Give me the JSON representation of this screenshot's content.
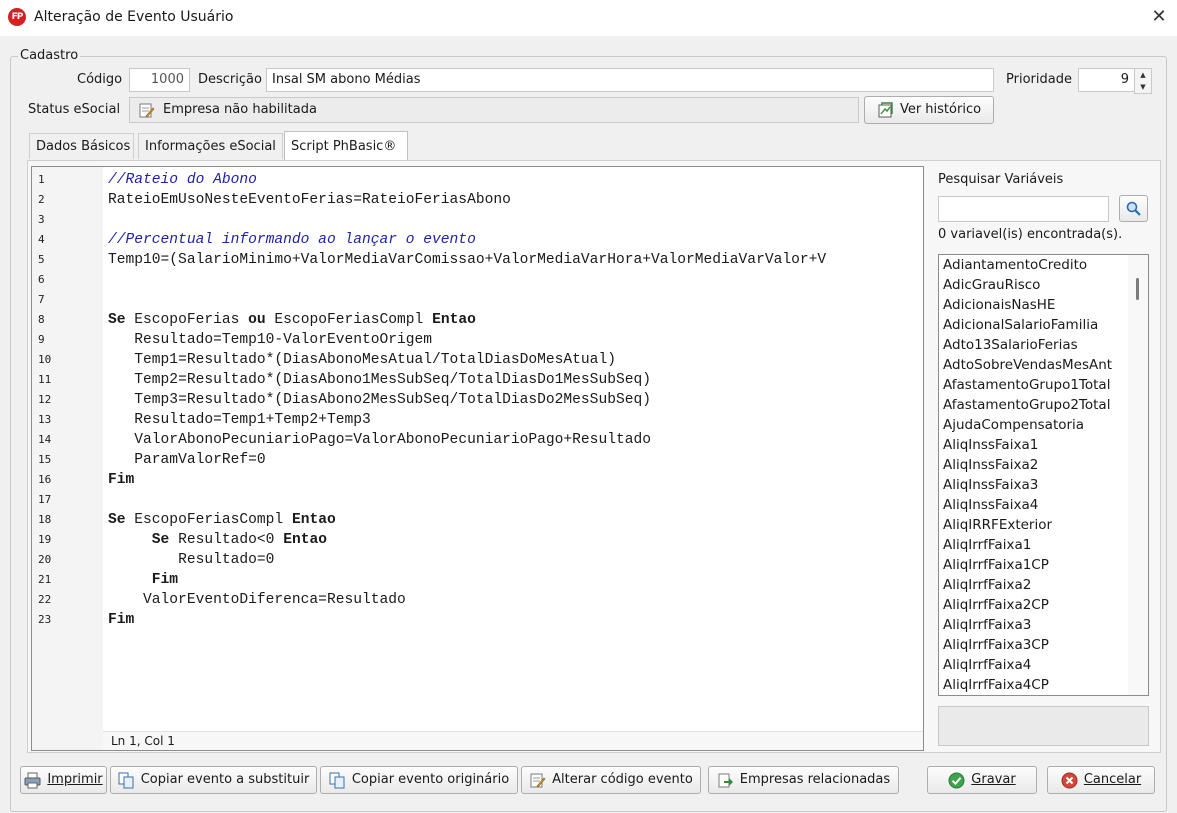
{
  "window": {
    "logo_text": "FP",
    "title": "Alteração de Evento Usuário",
    "close_glyph": "✕"
  },
  "cadastro": {
    "legend": "Cadastro",
    "codigo_label": "Código",
    "codigo_value": "1000",
    "descricao_label": "Descrição",
    "descricao_value": "Insal SM abono Médias",
    "prioridade_label": "Prioridade",
    "prioridade_value": "9",
    "status_label": "Status eSocial",
    "status_value": "Empresa não habilitada",
    "ver_historico": "Ver histórico"
  },
  "tabs": [
    {
      "label": "Dados Básicos",
      "active": false
    },
    {
      "label": "Informações eSocial",
      "active": false
    },
    {
      "label": "Script PhBasic®",
      "active": true
    }
  ],
  "editor": {
    "line_numbers": [
      "1",
      "2",
      "3",
      "4",
      "5",
      "6",
      "7",
      "8",
      "9",
      "10",
      "11",
      "12",
      "13",
      "14",
      "15",
      "16",
      "17",
      "18",
      "19",
      "20",
      "21",
      "22",
      "23"
    ],
    "lines": [
      "//Rateio do Abono",
      "RateioEmUsoNesteEventoFerias=RateioFeriasAbono",
      "",
      "//Percentual informando ao lançar o evento",
      "Temp10=(SalarioMinimo+ValorMediaVarComissao+ValorMediaVarHora+ValorMediaVarValor+V",
      "",
      "",
      "Se EscopoFerias ou EscopoFeriasCompl Entao",
      "   Resultado=Temp10-ValorEventoOrigem",
      "   Temp1=Resultado*(DiasAbonoMesAtual/TotalDiasDoMesAtual)",
      "   Temp2=Resultado*(DiasAbono1MesSubSeq/TotalDiasDo1MesSubSeq)",
      "   Temp3=Resultado*(DiasAbono2MesSubSeq/TotalDiasDo2MesSubSeq)",
      "   Resultado=Temp1+Temp2+Temp3",
      "   ValorAbonoPecuniarioPago=ValorAbonoPecuniarioPago+Resultado",
      "   ParamValorRef=0",
      "Fim",
      "",
      "Se EscopoFeriasCompl Entao",
      "     Se Resultado<0 Entao",
      "        Resultado=0",
      "     Fim",
      "    ValorEventoDiferenca=Resultado",
      "Fim"
    ],
    "status": "Ln 1, Col 1"
  },
  "variables": {
    "search_label": "Pesquisar Variáveis",
    "search_value": "",
    "found_text": "0 variavel(is) encontrada(s).",
    "items": [
      "AdiantamentoCredito",
      "AdicGrauRisco",
      "AdicionaisNasHE",
      "AdicionalSalarioFamilia",
      "Adto13SalarioFerias",
      "AdtoSobreVendasMesAnt",
      "AfastamentoGrupo1Total",
      "AfastamentoGrupo2Total",
      "AjudaCompensatoria",
      "AliqInssFaixa1",
      "AliqInssFaixa2",
      "AliqInssFaixa3",
      "AliqInssFaixa4",
      "AliqIRRFExterior",
      "AliqIrrfFaixa1",
      "AliqIrrfFaixa1CP",
      "AliqIrrfFaixa2",
      "AliqIrrfFaixa2CP",
      "AliqIrrfFaixa3",
      "AliqIrrfFaixa3CP",
      "AliqIrrfFaixa4",
      "AliqIrrfFaixa4CP"
    ]
  },
  "buttons": {
    "imprimir": "Imprimir",
    "copiar_substituir": "Copiar evento a substituir",
    "copiar_originario": "Copiar evento originário",
    "alterar_codigo": "Alterar código evento",
    "empresas": "Empresas relacionadas",
    "gravar": "Gravar",
    "cancelar": "Cancelar"
  },
  "colors": {
    "comment": "#1f1fa8",
    "logo": "#d42121",
    "gravar_icon": "#3fa34d",
    "cancelar_icon": "#d9453b"
  }
}
